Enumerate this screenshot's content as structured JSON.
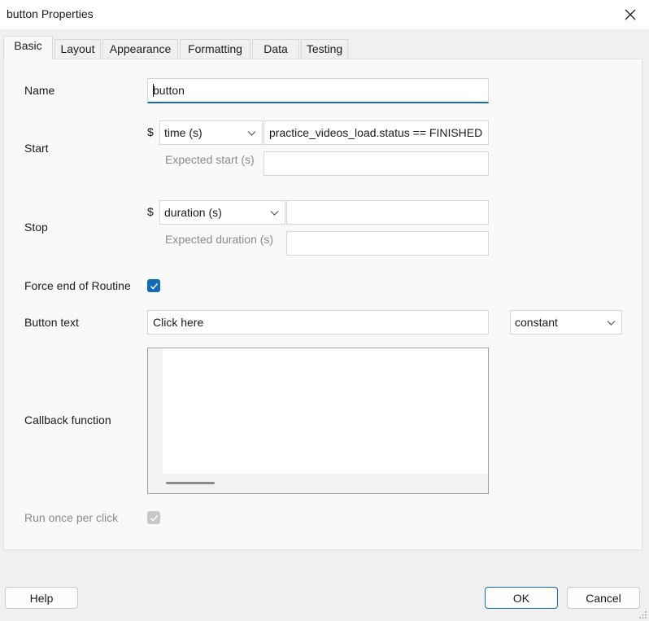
{
  "window": {
    "title": "button Properties"
  },
  "tabs": [
    "Basic",
    "Layout",
    "Appearance",
    "Formatting",
    "Data",
    "Testing"
  ],
  "basic": {
    "name": {
      "label": "Name",
      "value": "button"
    },
    "start": {
      "label": "Start",
      "dollar": "$",
      "type": "time (s)",
      "value": "practice_videos_load.status == FINISHED",
      "expected_label": "Expected start (s)",
      "expected_value": ""
    },
    "stop": {
      "label": "Stop",
      "dollar": "$",
      "type": "duration (s)",
      "value": "",
      "expected_label": "Expected duration (s)",
      "expected_value": ""
    },
    "force_end": {
      "label": "Force end of Routine",
      "checked": true
    },
    "button_text": {
      "label": "Button text",
      "value": "Click here",
      "update": "constant"
    },
    "callback": {
      "label": "Callback function",
      "value": ""
    },
    "run_once": {
      "label": "Run once per click",
      "checked": true,
      "enabled": false
    }
  },
  "footer": {
    "help": "Help",
    "ok": "OK",
    "cancel": "Cancel"
  },
  "colors": {
    "accent": "#0f6cbd",
    "disabled": "#c8c8c8",
    "muted_text": "#8a8a8a"
  }
}
